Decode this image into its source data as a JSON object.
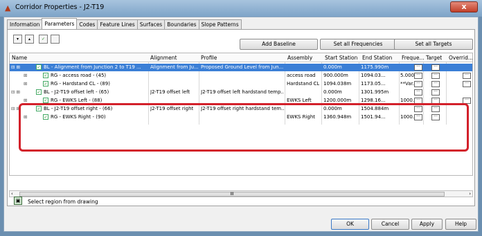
{
  "window": {
    "title": "Corridor Properties - J2-T19",
    "close": "x"
  },
  "tabs": [
    "Information",
    "Parameters",
    "Codes",
    "Feature Lines",
    "Surfaces",
    "Boundaries",
    "Slope Patterns"
  ],
  "toolbar": {
    "add_baseline": "Add Baseline",
    "set_all_frequencies": "Set all Frequencies",
    "set_all_targets": "Set all Targets"
  },
  "grid": {
    "columns": [
      "Name",
      "Alignment",
      "Profile",
      "Assembly",
      "Start Station",
      "End Station",
      "Freque...",
      "Target",
      "Overrid..."
    ],
    "rows": [
      {
        "name": "BL - Alignment from Junction 2 to T19 ...",
        "alignment": "Alignment from Ju...",
        "profile": "Proposed Ground Level from Jun...",
        "assembly": "",
        "start": "0.000m",
        "end": "1175.990m",
        "freq": "",
        "selected": true,
        "level": 0
      },
      {
        "name": "RG - access road - (45)",
        "alignment": "",
        "profile": "",
        "assembly": "access road",
        "start": "900.000m",
        "end": "1094.03...",
        "freq": "5.000...",
        "selected": false,
        "level": 1
      },
      {
        "name": "RG - Hardstand CL - (89)",
        "alignment": "",
        "profile": "",
        "assembly": "Hardstand CL",
        "start": "1094.038m",
        "end": "1173.05...",
        "freq": "**Var...",
        "selected": false,
        "level": 1
      },
      {
        "name": "BL - J2-T19 offset left - (65)",
        "alignment": "J2-T19 offset left",
        "profile": "J2-T19 offset left hardstand temp...",
        "assembly": "",
        "start": "0.000m",
        "end": "1301.995m",
        "freq": "",
        "selected": false,
        "level": 0
      },
      {
        "name": "RG - EWKS Left - (88)",
        "alignment": "",
        "profile": "",
        "assembly": "EWKS Left",
        "start": "1200.000m",
        "end": "1298.16...",
        "freq": "1000...",
        "selected": false,
        "level": 1
      },
      {
        "name": "BL - J2-T19 offset right - (66)",
        "alignment": "J2-T19 offset right",
        "profile": "J2-T19 offset right hardstand tem...",
        "assembly": "",
        "start": "0.000m",
        "end": "1504.884m",
        "freq": "",
        "selected": false,
        "level": 0
      },
      {
        "name": "RG - EWKS Right - (90)",
        "alignment": "",
        "profile": "",
        "assembly": "EWKS Right",
        "start": "1360.948m",
        "end": "1501.94...",
        "freq": "1000...",
        "selected": false,
        "level": 1
      }
    ]
  },
  "scrollbar": {
    "left": "‹",
    "right": "›",
    "thumb": "III"
  },
  "region_label": "Select region from drawing",
  "footer": {
    "ok": "OK",
    "cancel": "Cancel",
    "apply": "Apply",
    "help": "Help"
  },
  "colors": {
    "selection": "#3b7fd6",
    "highlight_box": "#d3202a"
  }
}
